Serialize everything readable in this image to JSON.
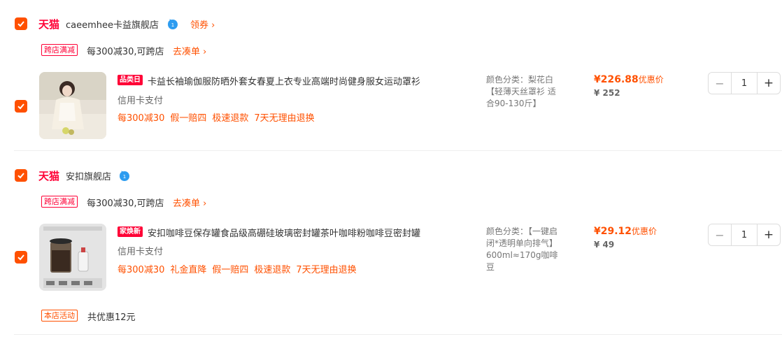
{
  "stores": [
    {
      "platform": "天猫",
      "name": "caeemhee卡益旗舰店",
      "coupon_label": "领券 ›",
      "promo_tag": "跨店满减",
      "promo_text": "每300减30,可跨店",
      "promo_link": "去凑单 ›",
      "item": {
        "badge": "品类日",
        "title": "卡益长袖瑜伽服防晒外套女春夏上衣专业高端时尚健身服女运动罩衫",
        "payment": "信用卡支付",
        "services": [
          "每300减30",
          "假一赔四",
          "极速退款",
          "7天无理由退换"
        ],
        "sku": "颜色分类：梨花白【轻薄天丝罩衫 适合90-130斤】",
        "price": "226.88",
        "price_prefix": "¥",
        "price_note": "优惠价",
        "original_price": "¥ 252",
        "quantity": "1"
      }
    },
    {
      "platform": "天猫",
      "name": "安扣旗舰店",
      "promo_tag": "跨店满减",
      "promo_text": "每300减30,可跨店",
      "promo_link": "去凑单 ›",
      "item": {
        "badge": "家焕新",
        "title": "安扣咖啡豆保存罐食品级高硼硅玻璃密封罐茶叶咖啡粉咖啡豆密封罐",
        "payment": "信用卡支付",
        "services": [
          "每300减30",
          "礼金直降",
          "假一赔四",
          "极速退款",
          "7天无理由退换"
        ],
        "sku": "颜色分类：【一键启闭*透明单向排气】600ml≈170g咖啡豆",
        "price": "29.12",
        "price_prefix": "¥",
        "price_note": "优惠价",
        "original_price": "¥ 49",
        "quantity": "1"
      },
      "store_activity_tag": "本店活动",
      "store_activity_text": "共优惠12元"
    }
  ],
  "colors": {
    "accent": "#ff5000",
    "tmall": "#ff0036"
  },
  "icons": {
    "check": "check-icon",
    "wangwang": "wangwang-chat-icon",
    "minus": "minus-icon",
    "plus": "plus-icon"
  }
}
